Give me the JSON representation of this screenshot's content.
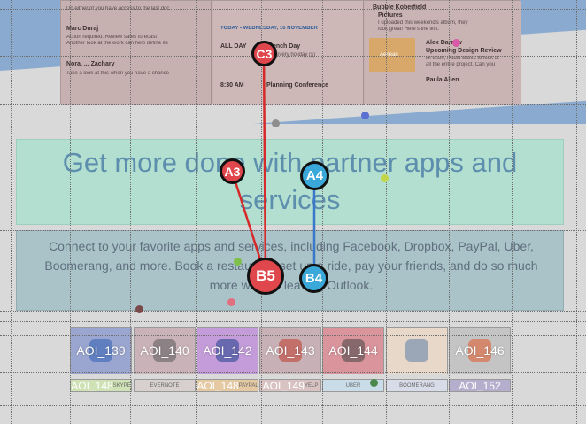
{
  "preview": {
    "left_rows": [
      {
        "name": "",
        "line1": "Do either of you have access to the last doc",
        "line2": ""
      },
      {
        "name": "Marc Duraj",
        "line1": "Action required: Review sales forecast",
        "line2": "Another look at the work can help define its"
      },
      {
        "name": "Nora, ... Zachary",
        "line1": "Take a look at this when you have a chance",
        "line2": ""
      }
    ],
    "mid": {
      "date_header": "TODAY • WEDNESDAY, 16 NOVEMBER",
      "all_day": "ALL DAY",
      "event": "French Day",
      "event_sub": "Not every holiday (s)",
      "time": "8:30 AM",
      "event2": "Planning Conference"
    },
    "right": {
      "line1": "Bubble Koberfield",
      "line2": "Pictures",
      "line3": "I uploaded this weekend's album, they",
      "line4": "look great! Here's the link.",
      "card_text": "Aenean",
      "person": "Alex Darrow",
      "subject": "Upcoming Design Review",
      "snippet1": "Hi team, Paula wants to look at",
      "snippet2": "all the entire project. Can you",
      "footer": "Paula Allen"
    }
  },
  "headline": "Get more done with partner apps and services",
  "description": "Connect to your favorite apps and services, including Facebook, Dropbox, PayPal, Uber, Boomerang, and more. Book a restaurant, set up a ride, pay your friends, and do so much more without leaving Outlook.",
  "tiles": [
    {
      "label": "AOI_139",
      "bg": "#9aa6cf",
      "icon": "#2f5fb6"
    },
    {
      "label": "AOI_140",
      "bg": "#c9b2b8",
      "icon": "#5a5a5a"
    },
    {
      "label": "AOI_142",
      "bg": "#c39cd9",
      "icon": "#1f3f8e"
    },
    {
      "label": "AOI_143",
      "bg": "#c8b1b6",
      "icon": "#c0392b"
    },
    {
      "label": "AOI_144",
      "bg": "#d9949c",
      "icon": "#444444"
    },
    {
      "label": "",
      "bg": "#e8d8c9",
      "icon": "#5b7fa6"
    },
    {
      "label": "AOI_146",
      "bg": "#c4c4c4",
      "icon": "#e25a2a"
    }
  ],
  "tile_labels": [
    {
      "label": "AOI_148",
      "bg": "#cfe2b5",
      "small": "SKYPE"
    },
    {
      "label": "",
      "bg": "#d7d0cf",
      "small": "EVERNOTE"
    },
    {
      "label": "AOI_148",
      "bg": "#e4c9a3",
      "small": "PAYPAL"
    },
    {
      "label": "AOI_149",
      "bg": "#d8c2c2",
      "small": "YELP"
    },
    {
      "label": "",
      "bg": "#c9dce8",
      "small": "UBER"
    },
    {
      "label": "",
      "bg": "#d8dce8",
      "small": "BOOMERANG"
    },
    {
      "label": "AOI_152",
      "bg": "#b6aecd",
      "small": ""
    }
  ],
  "markers": {
    "C3": "C3",
    "A3": "A3",
    "A4": "A4",
    "B5": "B5",
    "B4": "B4"
  },
  "colors": {
    "red_marker": "#e0474c",
    "blue_marker": "#3aa8d8",
    "red_line": "#d62a2a",
    "blue_line": "#3a78c9"
  }
}
